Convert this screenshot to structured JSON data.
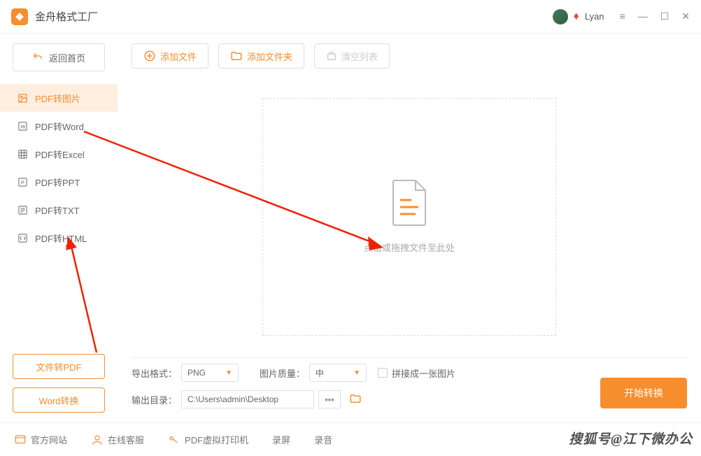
{
  "app": {
    "title": "金舟格式工厂"
  },
  "user": {
    "name": "Lyan"
  },
  "sidebar": {
    "back": "返回首页",
    "items": [
      {
        "label": "PDF转图片"
      },
      {
        "label": "PDF转Word"
      },
      {
        "label": "PDF转Excel"
      },
      {
        "label": "PDF转PPT"
      },
      {
        "label": "PDF转TXT"
      },
      {
        "label": "PDF转HTML"
      }
    ],
    "file_to_pdf": "文件转PDF",
    "word_convert": "Word转换"
  },
  "toolbar": {
    "add_file": "添加文件",
    "add_folder": "添加文件夹",
    "clear_list": "清空列表"
  },
  "dropzone": {
    "text": "点击或拖拽文件至此处"
  },
  "controls": {
    "export_format_label": "导出格式：",
    "export_format_value": "PNG",
    "image_quality_label": "图片质量：",
    "image_quality_value": "中",
    "merge_label": "拼接成一张图片",
    "output_dir_label": "输出目录：",
    "output_dir_value": "C:\\Users\\admin\\Desktop",
    "convert": "开始转换"
  },
  "footer": {
    "website": "官方网站",
    "support": "在线客服",
    "printer": "PDF虚拟打印机",
    "record_screen": "录屏",
    "record_audio": "录音"
  },
  "watermark": "搜狐号@江下微办公"
}
